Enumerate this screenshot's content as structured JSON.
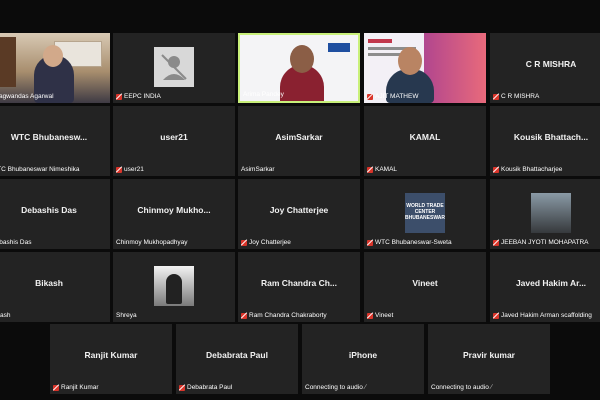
{
  "meeting": {
    "rows": [
      [
        {
          "id": "bhagwandas",
          "name": "",
          "label": "Bhagwandas Agarwal",
          "muted": false,
          "video": "office"
        },
        {
          "id": "eepc",
          "name": "",
          "label": "EEPC INDIA",
          "muted": true,
          "video": "avatar-gray"
        },
        {
          "id": "arima",
          "name": "",
          "label": "Arima Pandey",
          "muted": false,
          "video": "white",
          "active": true
        },
        {
          "id": "ajit",
          "name": "",
          "label": "AJIT MATHEW",
          "muted": true,
          "video": "slide"
        },
        {
          "id": "crmishra",
          "name": "C R MISHRA",
          "label": "C R MISHRA",
          "muted": true,
          "video": "none"
        }
      ],
      [
        {
          "id": "wtcnim",
          "name": "WTC Bhubanesw...",
          "label": "WTC Bhubaneswar Nimeshika",
          "muted": false,
          "video": "none"
        },
        {
          "id": "user21",
          "name": "user21",
          "label": "user21",
          "muted": true,
          "video": "none"
        },
        {
          "id": "asim",
          "name": "AsimSarkar",
          "label": "AsimSarkar",
          "muted": false,
          "video": "none"
        },
        {
          "id": "kamal",
          "name": "KAMAL",
          "label": "KAMAL",
          "muted": true,
          "video": "none"
        },
        {
          "id": "kousik",
          "name": "Kousik Bhattach...",
          "label": "Kousik Bhattacharjee",
          "muted": true,
          "video": "none"
        }
      ],
      [
        {
          "id": "debashis",
          "name": "Debashis Das",
          "label": "Debashis Das",
          "muted": false,
          "video": "none"
        },
        {
          "id": "chinmoy",
          "name": "Chinmoy Mukho...",
          "label": "Chinmoy Mukhopadhyay",
          "muted": false,
          "video": "none"
        },
        {
          "id": "joy",
          "name": "Joy Chatterjee",
          "label": "Joy Chatterjee",
          "muted": true,
          "video": "none"
        },
        {
          "id": "wtcsweta",
          "name": "",
          "label": "WTC Bhubaneswar-Sweta",
          "muted": true,
          "video": "avatar-wtc",
          "avatar_text": "WORLD TRADE CENTER BHUBANESWAR"
        },
        {
          "id": "jeeban",
          "name": "",
          "label": "JEEBAN JYOTI MOHAPATRA",
          "muted": true,
          "video": "avatar-moto"
        }
      ],
      [
        {
          "id": "bikash",
          "name": "Bikash",
          "label": "Bikash",
          "muted": false,
          "video": "none"
        },
        {
          "id": "shreya",
          "name": "",
          "label": "Shreya",
          "muted": false,
          "video": "avatar-bw"
        },
        {
          "id": "ramchandra",
          "name": "Ram Chandra Ch...",
          "label": "Ram Chandra Chakraborty",
          "muted": true,
          "video": "none"
        },
        {
          "id": "vineet",
          "name": "Vineet",
          "label": "Vineet",
          "muted": true,
          "video": "none"
        },
        {
          "id": "javed",
          "name": "Javed Hakim Ar...",
          "label": "Javed Hakim Arman scaffolding",
          "muted": true,
          "video": "none"
        }
      ],
      [
        {
          "id": "ranjit",
          "name": "Ranjit Kumar",
          "label": "Ranjit Kumar",
          "muted": true,
          "video": "none"
        },
        {
          "id": "debabrata",
          "name": "Debabrata Paul",
          "label": "Debabrata Paul",
          "muted": true,
          "video": "none"
        },
        {
          "id": "iphone",
          "name": "iPhone",
          "label": "Connecting to audio",
          "muted": false,
          "connecting": true,
          "video": "none"
        },
        {
          "id": "pravir",
          "name": "Pravir kumar",
          "label": "Connecting to audio",
          "muted": false,
          "connecting": true,
          "video": "none"
        }
      ]
    ]
  },
  "colors": {
    "background": "#0b0b0b",
    "tile": "#232323",
    "active_border": "#c9f07a",
    "muted_icon": "#d9352b"
  }
}
